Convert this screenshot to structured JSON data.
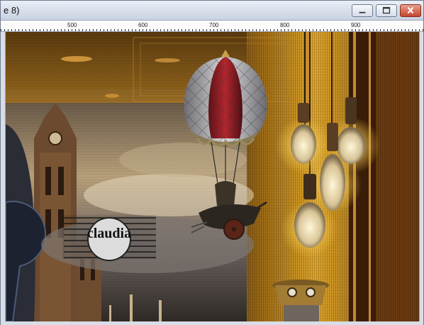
{
  "window": {
    "title": "e 8)"
  },
  "controls": {
    "minimize": "minimize-icon",
    "maximize": "maximize-icon",
    "close": "close-icon"
  },
  "ruler": {
    "labels": [
      "500",
      "600",
      "700",
      "800",
      "900"
    ]
  },
  "watermark": {
    "name": "claudia"
  },
  "colors": {
    "titlebar": "#dbe3ee",
    "close": "#c4442e",
    "gold": "#d9a028",
    "balloon_red": "#a6222a"
  }
}
